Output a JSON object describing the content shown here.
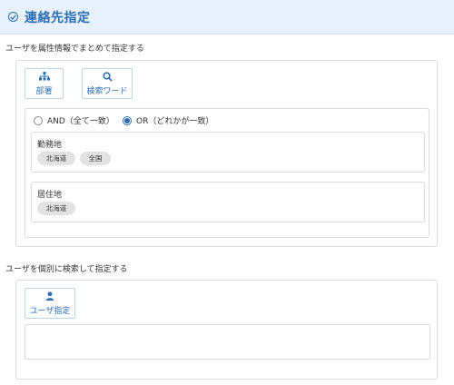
{
  "header": {
    "title": "連絡先指定"
  },
  "attr_section": {
    "label": "ユーザを属性情報でまとめて指定する",
    "buttons": [
      {
        "label": "部署",
        "icon": "org-chart-icon"
      },
      {
        "label": "検索ワード",
        "icon": "search-icon"
      }
    ],
    "radio": [
      {
        "label": "AND（全て一致）",
        "selected": false
      },
      {
        "label": "OR（どれかが一致）",
        "selected": true
      }
    ],
    "groups": [
      {
        "label": "勤務地",
        "chips": [
          "北海道",
          "全国"
        ]
      },
      {
        "label": "居住地",
        "chips": [
          "北海道"
        ]
      }
    ]
  },
  "individual_section": {
    "label": "ユーザを個別に検索して指定する",
    "button": {
      "label": "ユーザ指定",
      "icon": "user-icon"
    },
    "textarea_value": ""
  },
  "colors": {
    "accent": "#2a6db5",
    "header_bg": "#e6f1fb",
    "chip_bg": "#e2e2e2"
  }
}
